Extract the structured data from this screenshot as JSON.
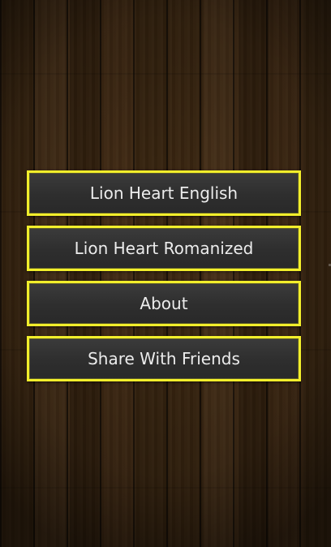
{
  "menu": {
    "buttons": [
      {
        "label": "Lion Heart English"
      },
      {
        "label": "Lion Heart Romanized"
      },
      {
        "label": "About"
      },
      {
        "label": "Share With Friends"
      }
    ]
  },
  "colors": {
    "button_border": "#f2ee2b",
    "button_fill": "#2e2e2e",
    "button_text": "#ececec",
    "background_wood": "#3d2812"
  }
}
